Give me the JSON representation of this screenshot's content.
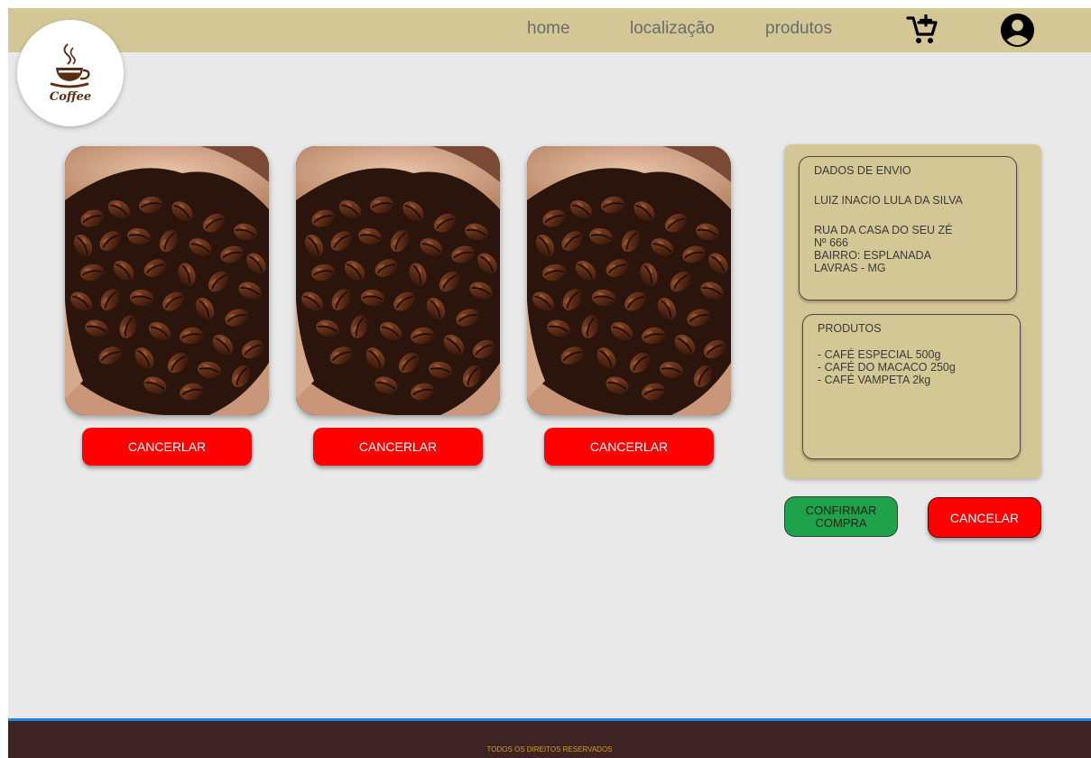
{
  "nav": {
    "links": [
      "home",
      "localização",
      "produtos"
    ]
  },
  "logo": {
    "text": "Coffee"
  },
  "products": [
    {
      "cancel_label": "CANCERLAR"
    },
    {
      "cancel_label": "CANCERLAR"
    },
    {
      "cancel_label": "CANCERLAR"
    }
  ],
  "shipping": {
    "title": "DADOS DE ENVIO",
    "name": "LUIZ INACIO LULA DA SILVA",
    "address_lines": [
      "RUA DA CASA DO SEU ZÉ",
      "Nº 666",
      "BAIRRO: ESPLANADA",
      "LAVRAS - MG"
    ]
  },
  "order": {
    "title": "PRODUTOS",
    "items": [
      "- CAFÉ ESPECIAL 500g",
      "- CAFÉ DO MACACO 250g",
      "- CAFÉ VAMPETA 2kg"
    ]
  },
  "actions": {
    "confirm_label": "CONFIRMAR COMPRA",
    "cancel_label": "CANCELAR"
  },
  "footer": {
    "text": "TODOS OS DIREITOS RESERVADOS"
  },
  "icons": {
    "cart": "add-to-cart-icon",
    "account": "account-circle-icon",
    "logo": "coffee-cup-icon"
  },
  "colors": {
    "header": "#d4c796",
    "background": "#e9e9e9",
    "danger": "#ff0000",
    "confirm": "#1fa34a",
    "footer": "#3d2323",
    "footer_accent": "#1e88e5",
    "footer_text": "#d4a017"
  }
}
